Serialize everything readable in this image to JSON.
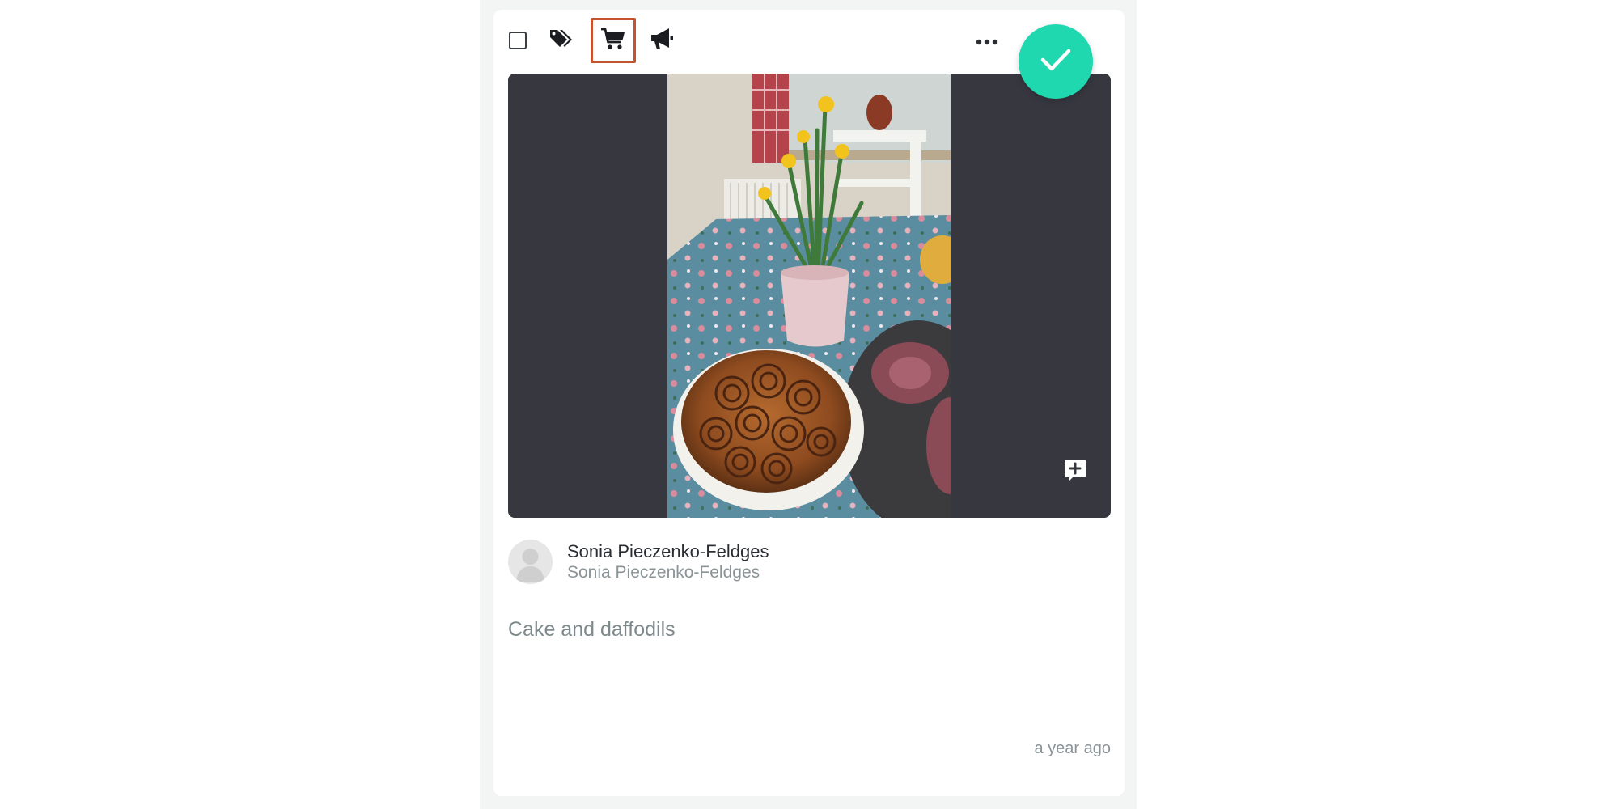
{
  "toolbar": {
    "select_icon": "checkbox-icon",
    "tags_icon": "tags-icon",
    "cart_icon": "shopping-cart-icon",
    "announce_icon": "megaphone-icon",
    "more_icon": "more-horizontal-icon",
    "approve_icon": "checkmark-icon",
    "cart_selected": true
  },
  "media": {
    "add_comment_icon": "comment-plus-icon"
  },
  "post": {
    "author_name": "Sonia Pieczenko-Feldges",
    "author_handle": "Sonia Pieczenko-Feldges",
    "avatar_icon": "default-avatar-icon",
    "caption": "Cake and daffodils",
    "timestamp": "a year ago"
  },
  "colors": {
    "accent": "#1fd8b0",
    "selected_outline": "#c4542f",
    "media_background": "#373740",
    "column_background": "#f3f4f4"
  }
}
